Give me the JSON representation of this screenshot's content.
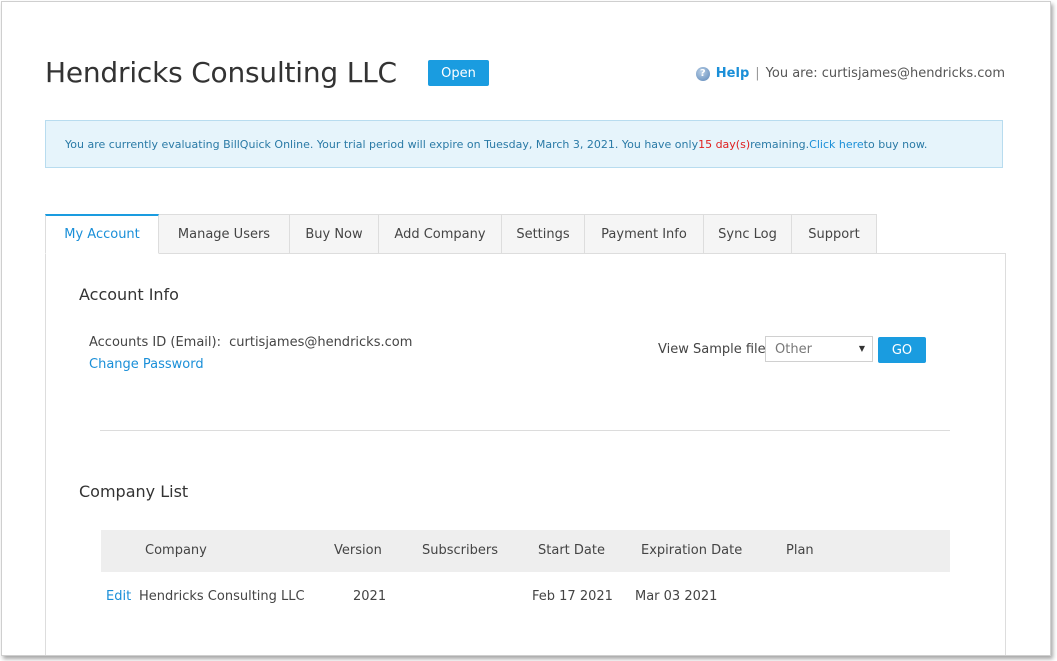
{
  "header": {
    "company_name": "Hendricks Consulting LLC",
    "status_button": "Open",
    "help_label": "Help",
    "separator": "|",
    "user_text": "You are: curtisjames@hendricks.com"
  },
  "banner": {
    "text_before": "You are currently evaluating BillQuick Online. Your trial period will expire on Tuesday, March 3, 2021. You have only ",
    "days": "15 day(s)",
    "text_middle": " remaining. ",
    "link": "Click here",
    "text_after": " to buy now."
  },
  "tabs": [
    {
      "label": "My Account",
      "active": true
    },
    {
      "label": "Manage Users",
      "active": false
    },
    {
      "label": "Buy Now",
      "active": false
    },
    {
      "label": "Add Company",
      "active": false
    },
    {
      "label": "Settings",
      "active": false
    },
    {
      "label": "Payment Info",
      "active": false
    },
    {
      "label": "Sync Log",
      "active": false
    },
    {
      "label": "Support",
      "active": false
    }
  ],
  "account_info": {
    "title": "Account Info",
    "id_label": "Accounts ID (Email):",
    "id_value": "curtisjames@hendricks.com",
    "change_password": "Change Password",
    "sample_label": "View Sample file",
    "sample_selected": "Other",
    "go_label": "GO"
  },
  "company_list": {
    "title": "Company List",
    "columns": [
      "Company",
      "Version",
      "Subscribers",
      "Start Date",
      "Expiration Date",
      "Plan"
    ],
    "rows": [
      {
        "action": "Edit",
        "company": "Hendricks Consulting LLC",
        "version": "2021",
        "subscribers": "",
        "start_date": "Feb 17 2021",
        "expiration_date": "Mar 03 2021",
        "plan": ""
      }
    ]
  },
  "colors": {
    "accent": "#1a9ce0",
    "link": "#1a8fd8",
    "banner_bg": "#e6f4fb",
    "warning": "#e02020"
  }
}
